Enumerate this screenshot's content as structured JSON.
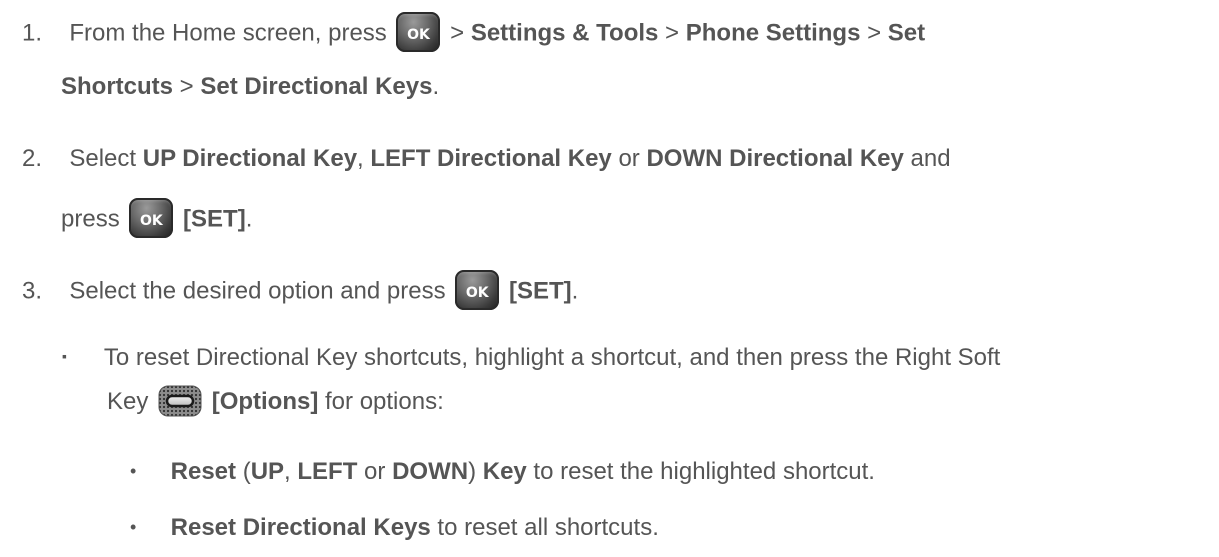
{
  "steps": [
    {
      "number": "1.",
      "line1": {
        "t1": "From the Home screen, press",
        "t2": " > ",
        "b1": "Settings & Tools",
        "t3": " > ",
        "b2": "Phone Settings",
        "t4": " > ",
        "b3": "Set"
      },
      "line2": {
        "b1": "Shortcuts",
        "t1": " > ",
        "b2": "Set Directional Keys",
        "t2": "."
      }
    },
    {
      "number": "2.",
      "line1": {
        "t1": "Select ",
        "b1": "UP Directional Key",
        "t2": ", ",
        "b2": "LEFT Directional Key",
        "t3": " or ",
        "b3": "DOWN Directional Key",
        "t4": " and"
      },
      "line2": {
        "t1": "press",
        "b1": "[SET]",
        "t2": "."
      }
    },
    {
      "number": "3.",
      "line1": {
        "t1": "Select the desired option and press",
        "b1": "[SET]",
        "t2": "."
      }
    }
  ],
  "sub_bullet": {
    "marker": "▪",
    "line1": "To reset Directional Key shortcuts, highlight a shortcut, and then press the Right Soft",
    "line2": {
      "t1": "Key",
      "b1": "[Options]",
      "t2": " for options:"
    }
  },
  "options": [
    {
      "marker": "•",
      "b1": "Reset",
      "t1": " (",
      "b2": "UP",
      "t2": ", ",
      "b3": "LEFT",
      "t3": " or ",
      "b4": "DOWN",
      "t4": ") ",
      "b5": "Key",
      "t5": " to reset the highlighted shortcut."
    },
    {
      "marker": "•",
      "b1": "Reset Directional Keys",
      "t1": " to reset all shortcuts."
    }
  ],
  "keys": {
    "ok_label": "OK",
    "ok_icon": "ok-key-icon",
    "soft_icon": "right-soft-key-icon"
  }
}
